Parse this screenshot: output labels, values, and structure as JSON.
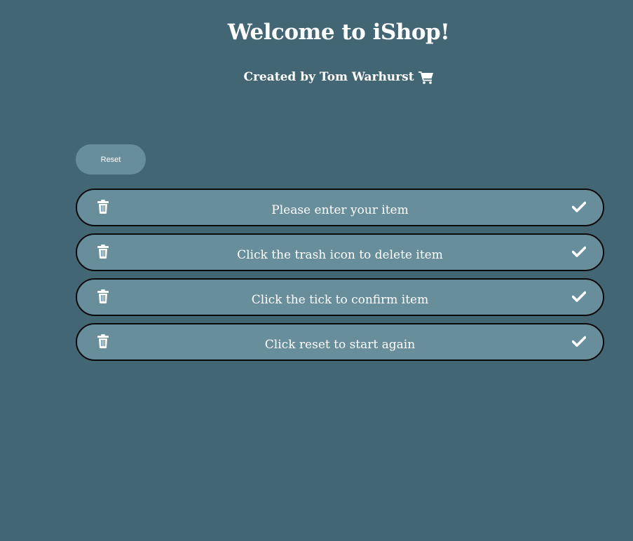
{
  "header": {
    "title": "Welcome to iShop!",
    "subtitle": "Created by Tom Warhurst",
    "subtitle_icon": "shopping-cart-icon"
  },
  "toolbar": {
    "reset_label": "Reset"
  },
  "items": [
    {
      "text": "Please enter your item",
      "delete_icon": "trash-icon",
      "confirm_icon": "check-icon"
    },
    {
      "text": "Click the trash icon to delete item",
      "delete_icon": "trash-icon",
      "confirm_icon": "check-icon"
    },
    {
      "text": "Click the tick to confirm item",
      "delete_icon": "trash-icon",
      "confirm_icon": "check-icon"
    },
    {
      "text": "Click reset to start again",
      "delete_icon": "trash-icon",
      "confirm_icon": "check-icon"
    }
  ],
  "colors": {
    "background": "#436674",
    "item_background": "#688e9b",
    "item_border": "#0a0a0a",
    "text": "#ffffff"
  }
}
